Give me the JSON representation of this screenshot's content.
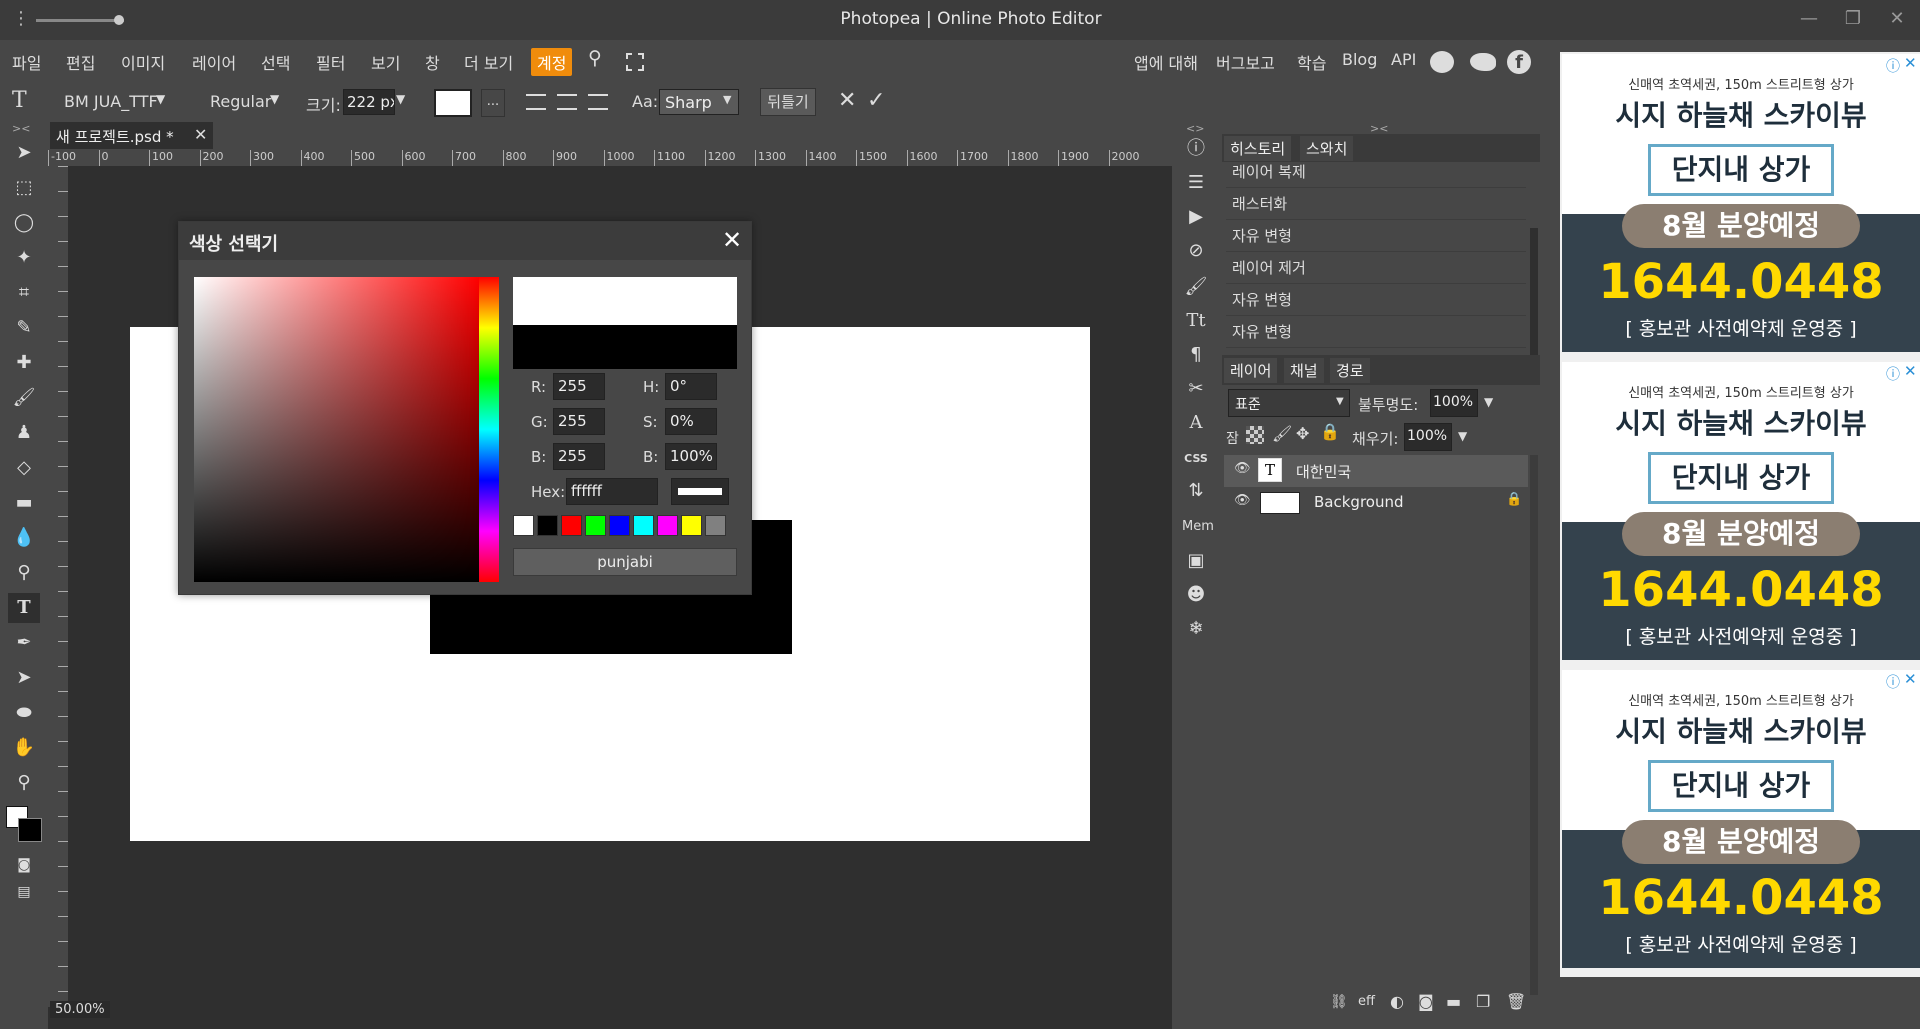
{
  "window": {
    "title": "Photopea | Online Photo Editor",
    "minimize": "—",
    "restore": "❐",
    "close": "✕",
    "menu_dots": "⋮"
  },
  "menu": {
    "items": [
      "파일",
      "편집",
      "이미지",
      "레이어",
      "선택",
      "필터",
      "보기",
      "창",
      "더 보기"
    ],
    "account": "계정",
    "right": [
      "앱에 대해",
      "버그보고",
      "학습",
      "Blog",
      "API"
    ]
  },
  "options": {
    "font": "BM JUA_TTF",
    "style": "Regular",
    "size_label": "크기:",
    "size_value": "222 px",
    "more": "...",
    "aa_label": "Aa:",
    "aa_value": "Sharp",
    "warp": "뒤틀기"
  },
  "tab": {
    "name": "새 프로젝트.psd *",
    "close": "✕"
  },
  "ruler_ticks": [
    "-100",
    "0",
    "100",
    "200",
    "300",
    "400",
    "500",
    "600",
    "700",
    "800",
    "900",
    "1000",
    "1100",
    "1200",
    "1300",
    "1400",
    "1500",
    "1600",
    "1700",
    "1800",
    "1900",
    "2000"
  ],
  "zoom": "50.00%",
  "color_picker": {
    "title": "색상 선택기",
    "close": "✕",
    "r_label": "R:",
    "r": "255",
    "g_label": "G:",
    "g": "255",
    "b_label": "B:",
    "b": "255",
    "h_label": "H:",
    "h": "0°",
    "s_label": "S:",
    "s": "0%",
    "v_label": "B:",
    "v": "100%",
    "hex_label": "Hex:",
    "hex": "ffffff",
    "swatches": [
      "#ffffff",
      "#000000",
      "#ff0000",
      "#00ff00",
      "#0000ff",
      "#00ffff",
      "#ff00ff",
      "#ffff00",
      "#808080"
    ],
    "font_button": "punjabi"
  },
  "history": {
    "tabs": [
      "히스토리",
      "스와치"
    ],
    "items": [
      "레이어 복제",
      "래스터화",
      "자유 변형",
      "레이어 제거",
      "자유 변형",
      "자유 변형"
    ]
  },
  "layers": {
    "tabs": [
      "레이어",
      "채널",
      "경로"
    ],
    "blend": "표준",
    "opacity_label": "불투명도:",
    "opacity": "100%",
    "lock_label": "잠금:",
    "fill_label": "채우기:",
    "fill": "100%",
    "rows": [
      {
        "name": "대한민국"
      },
      {
        "name": "Background"
      }
    ],
    "footer_eff": "eff"
  },
  "icon_col": {
    "css": "CSS",
    "mem": "Mem"
  },
  "ads": [
    {
      "line1": "신매역 초역세권, 150m 스트리트형 상가",
      "line2": "시지 하늘채 스카이뷰",
      "line3": "단지내 상가",
      "line4": "8월 분양예정",
      "phone": "1644.0448",
      "foot": "[ 홍보관 사전예약제 운영중 ]"
    },
    {
      "line1": "신매역 초역세권, 150m 스트리트형 상가",
      "line2": "시지 하늘채 스카이뷰",
      "line3": "단지내 상가",
      "line4": "8월 분양예정",
      "phone": "1644.0448",
      "foot": "[ 홍보관 사전예약제 운영중 ]"
    },
    {
      "line1": "신매역 초역세권, 150m 스트리트형 상가",
      "line2": "시지 하늘채 스카이뷰",
      "line3": "단지내 상가",
      "line4": "8월 분양예정",
      "phone": "1644.0448",
      "foot": "[ 홍보관 사전예약제 운영중 ]"
    }
  ],
  "colors": {
    "accent": "#f08c0c",
    "fg": "#ffffff",
    "bg": "#000000"
  }
}
